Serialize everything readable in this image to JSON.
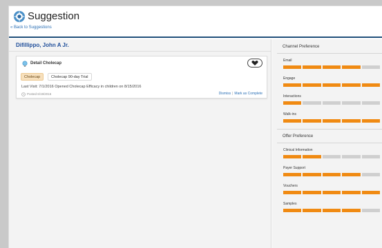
{
  "header": {
    "title": "Suggestion",
    "back_link": "« Back to Suggestions"
  },
  "main": {
    "contact_name": "Difillippo, John A Jr.",
    "card": {
      "title": "Detail Cholecap",
      "tags": [
        "Cholecap",
        "Cholecap 90-day Trial"
      ],
      "last_visit": "Last Visit: 7/1/2016 Opened Cholecap Efficacy in children on 8/15/2016",
      "posted": "Posted 6/19/2016",
      "dismiss_label": "Dismiss",
      "separator": "|",
      "complete_label": "Mark as Complete"
    }
  },
  "sidebar": {
    "channel_title": "Channel Preference",
    "channels": [
      {
        "label": "Email",
        "filled": 4
      },
      {
        "label": "Engage",
        "filled": 5
      },
      {
        "label": "Interactions",
        "filled": 1
      },
      {
        "label": "Walk-ins",
        "filled": 5
      }
    ],
    "offer_title": "Offer Preference",
    "offers": [
      {
        "label": "Clinical Information",
        "filled": 2
      },
      {
        "label": "Payer Support",
        "filled": 4
      },
      {
        "label": "Vouchers",
        "filled": 5
      },
      {
        "label": "Samples",
        "filled": 4
      }
    ],
    "segments_total": 5,
    "colors": {
      "filled": "#f08a12",
      "empty": "#cfcfcf"
    }
  },
  "colors": {
    "header_rule": "#1f4e79",
    "link": "#2a6fb5",
    "name": "#1f4e9a"
  }
}
